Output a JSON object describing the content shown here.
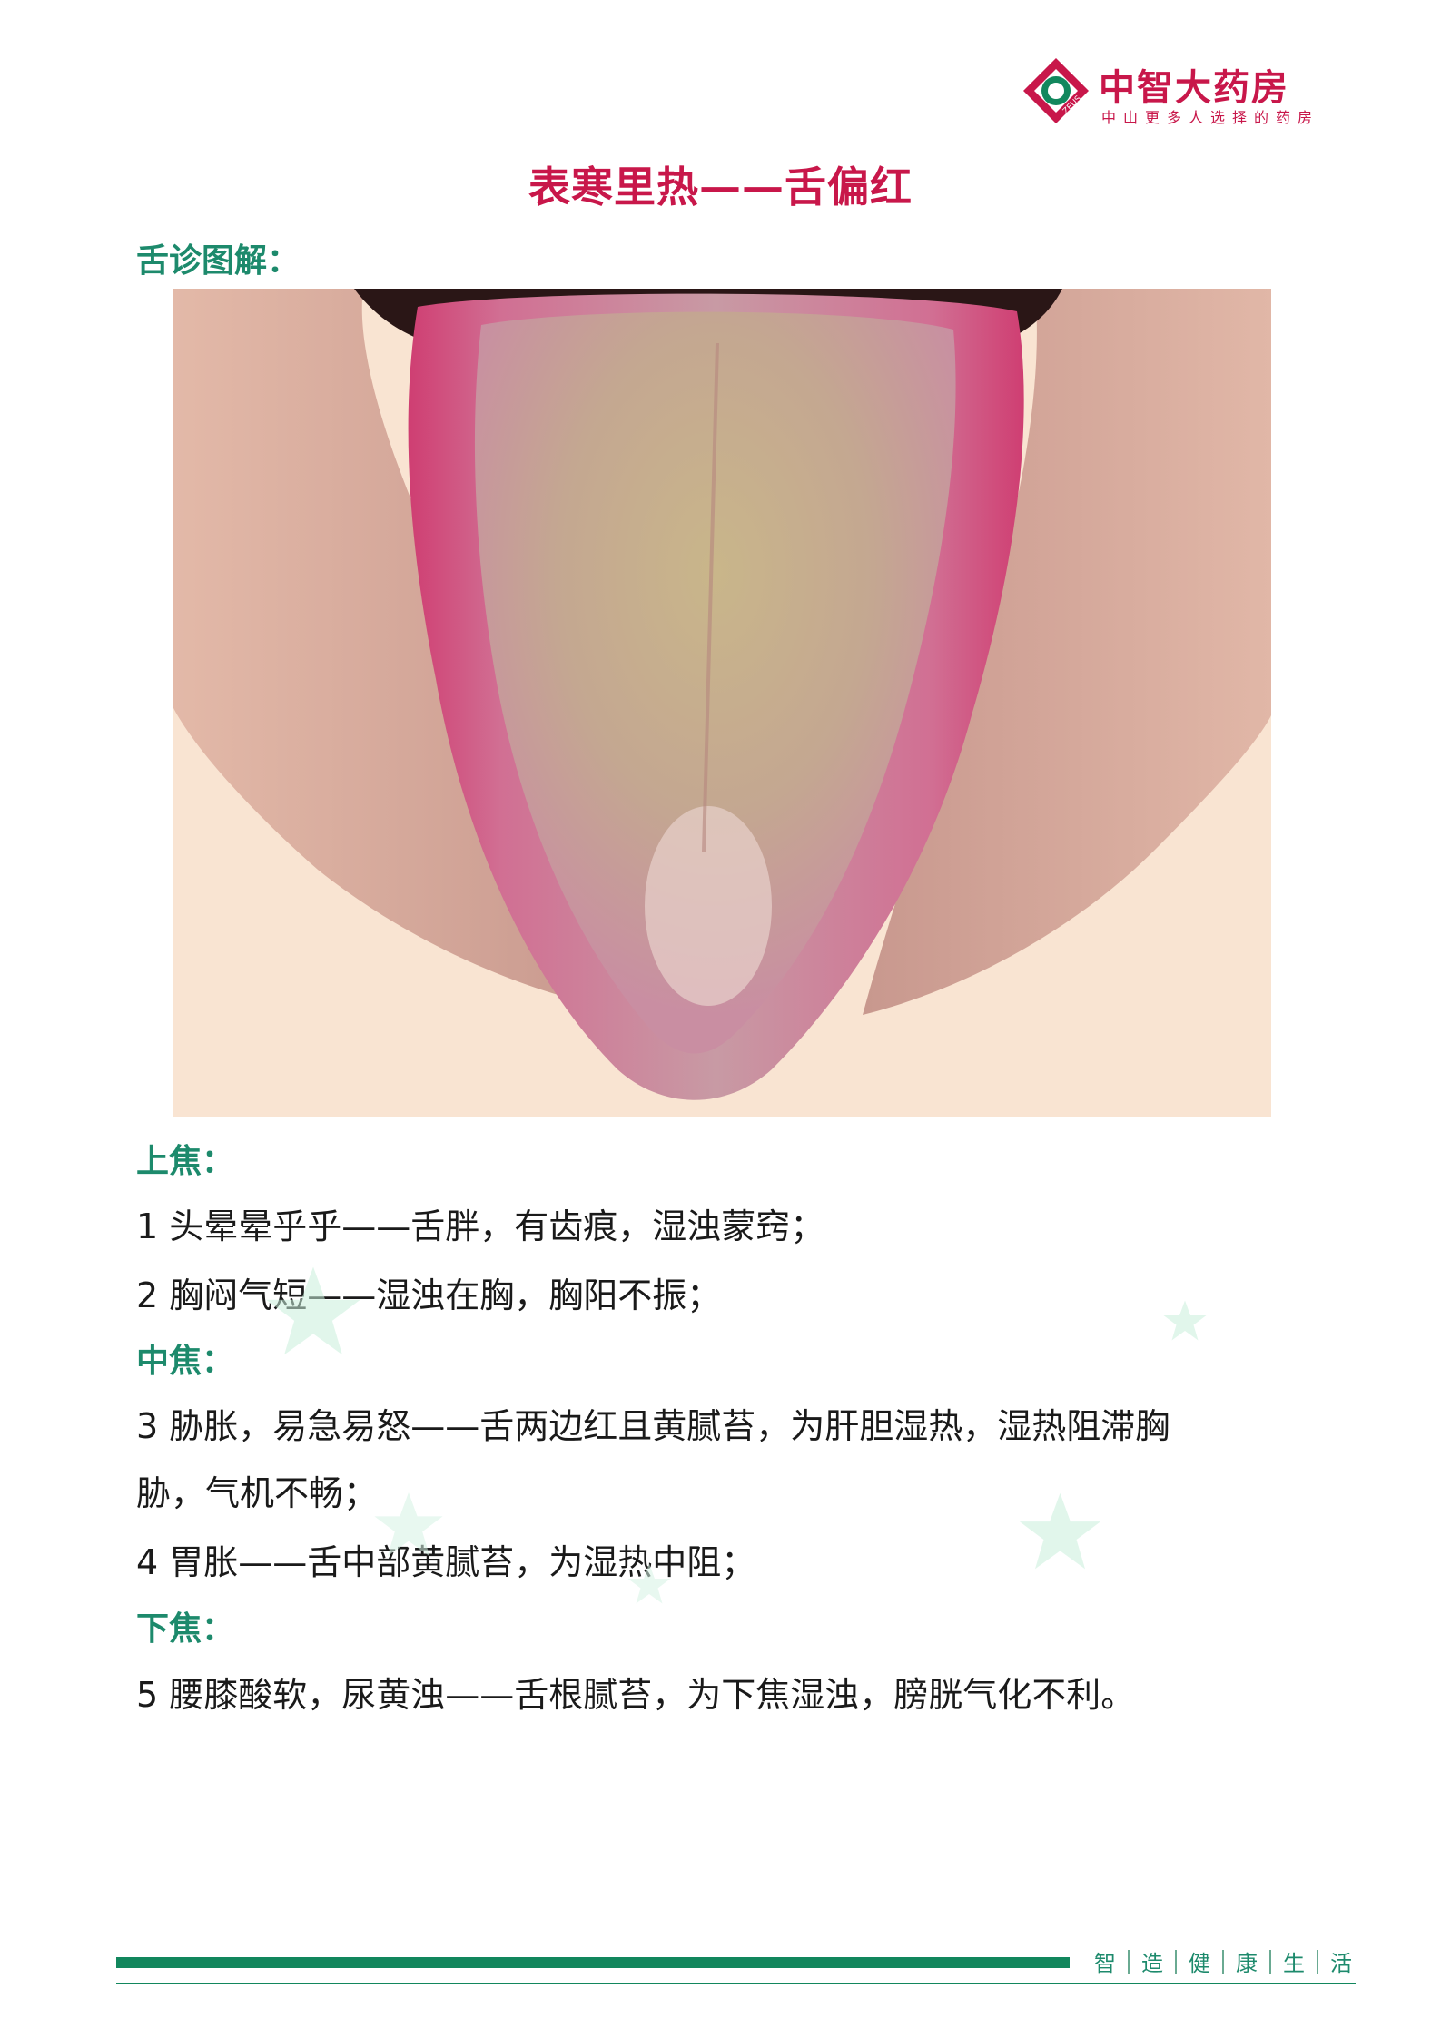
{
  "brand": {
    "name": "中智大药房",
    "slogan": "中山更多人选择的药房",
    "mark_text": "ZEUS",
    "colors": {
      "red": "#c8174a",
      "green": "#12875d"
    }
  },
  "title": "表寒里热——舌偏红",
  "sections": {
    "diagram_label": "舌诊图解：",
    "upper_label": "上焦：",
    "middle_label": "中焦：",
    "lower_label": "下焦："
  },
  "items": {
    "item1": "1  头晕晕乎乎——舌胖，有齿痕，湿浊蒙窍；",
    "item2": "2  胸闷气短——湿浊在胸，胸阳不振；",
    "item3_line1": "3  胁胀，易急易怒——舌两边红且黄腻苔，为肝胆湿热，湿热阻滞胸",
    "item3_line2": "胁，气机不畅；",
    "item4": "4  胃胀——舌中部黄腻苔，为湿热中阻；",
    "item5": "5  腰膝酸软，尿黄浊——舌根腻苔，为下焦湿浊，膀胱气化不利。"
  },
  "footer": {
    "words": [
      "智",
      "造",
      "健",
      "康",
      "生",
      "活"
    ]
  }
}
